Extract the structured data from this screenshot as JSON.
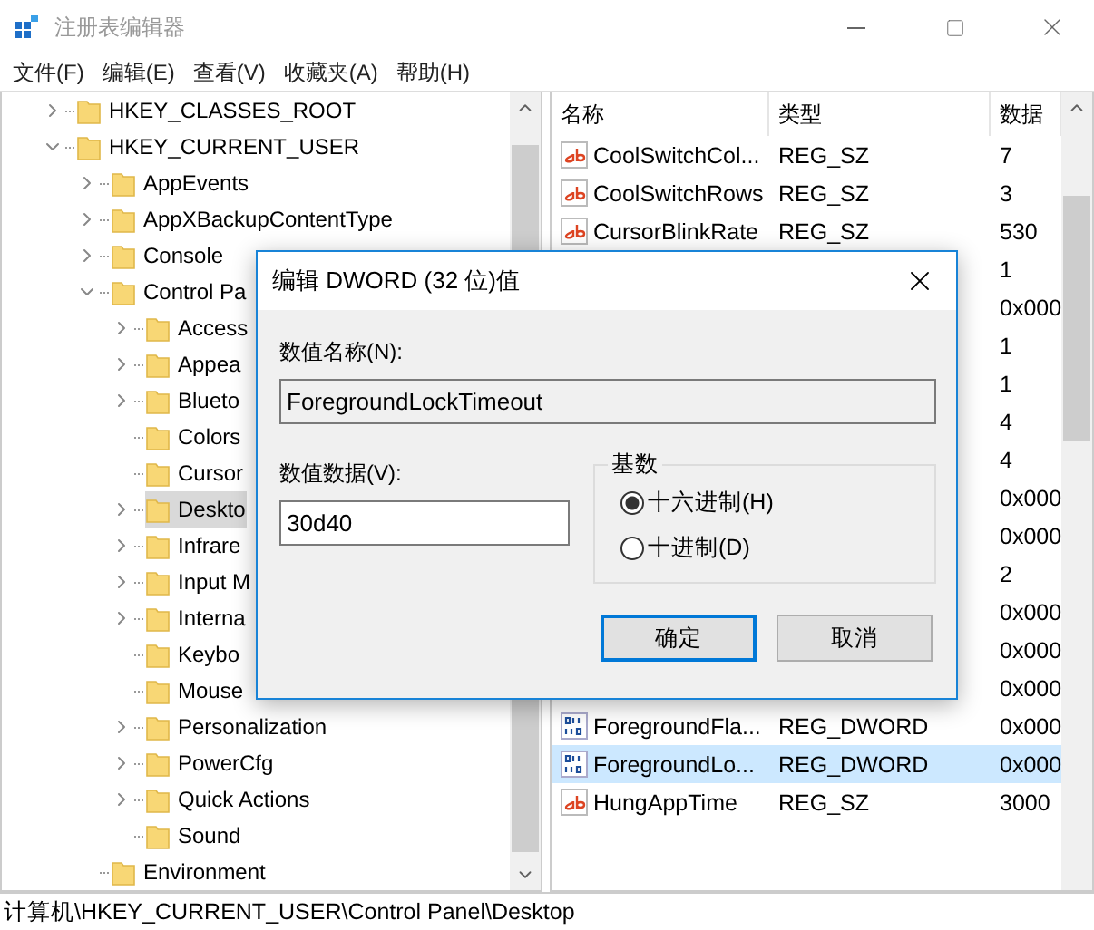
{
  "window": {
    "title": "注册表编辑器"
  },
  "menu": [
    "文件(F)",
    "编辑(E)",
    "查看(V)",
    "收藏夹(A)",
    "帮助(H)"
  ],
  "tree": [
    {
      "kind": "branch",
      "label": "HKEY_CLASSES_ROOT",
      "expanded": false,
      "selected": false
    },
    {
      "kind": "branch",
      "label": "HKEY_CURRENT_USER",
      "expanded": true,
      "selected": false,
      "children": [
        {
          "kind": "branch",
          "label": "AppEvents",
          "expanded": false,
          "selected": false
        },
        {
          "kind": "branch",
          "label": "AppXBackupContentType",
          "expanded": false,
          "selected": false
        },
        {
          "kind": "branch",
          "label": "Console",
          "expanded": false,
          "selected": false
        },
        {
          "kind": "branch",
          "label": "Control Pa",
          "expanded": true,
          "selected": false,
          "children": [
            {
              "kind": "branch",
              "label": "Access",
              "expanded": false,
              "selected": false
            },
            {
              "kind": "branch",
              "label": "Appea",
              "expanded": false,
              "selected": false
            },
            {
              "kind": "branch",
              "label": "Blueto",
              "expanded": false,
              "selected": false
            },
            {
              "kind": "leaf",
              "label": "Colors",
              "selected": false
            },
            {
              "kind": "leaf",
              "label": "Cursor",
              "selected": false
            },
            {
              "kind": "branch",
              "label": "Deskto",
              "expanded": false,
              "selected": true
            },
            {
              "kind": "branch",
              "label": "Infrare",
              "expanded": false,
              "selected": false
            },
            {
              "kind": "branch",
              "label": "Input M",
              "expanded": false,
              "selected": false
            },
            {
              "kind": "branch",
              "label": "Interna",
              "expanded": false,
              "selected": false
            },
            {
              "kind": "leaf",
              "label": "Keybo",
              "selected": false
            },
            {
              "kind": "leaf",
              "label": "Mouse",
              "selected": false
            },
            {
              "kind": "branch",
              "label": "Personalization",
              "expanded": false,
              "selected": false
            },
            {
              "kind": "branch",
              "label": "PowerCfg",
              "expanded": false,
              "selected": false
            },
            {
              "kind": "branch",
              "label": "Quick Actions",
              "expanded": false,
              "selected": false
            },
            {
              "kind": "leaf",
              "label": "Sound",
              "selected": false
            }
          ]
        },
        {
          "kind": "leaf",
          "label": "Environment",
          "selected": false
        }
      ]
    }
  ],
  "list": {
    "columns": [
      "名称",
      "类型",
      "数据"
    ],
    "rows": [
      {
        "kind": "string",
        "name": "CoolSwitchCol...",
        "type": "REG_SZ",
        "data": "7",
        "selected": false
      },
      {
        "kind": "string",
        "name": "CoolSwitchRows",
        "type": "REG_SZ",
        "data": "3",
        "selected": false
      },
      {
        "kind": "string",
        "name": "CursorBlinkRate",
        "type": "REG_SZ",
        "data": "530",
        "selected": false
      },
      {
        "data": "1",
        "selected": false
      },
      {
        "data": "0x000",
        "selected": false
      },
      {
        "data": "1",
        "selected": false
      },
      {
        "data": "1",
        "selected": false
      },
      {
        "data": "4",
        "selected": false
      },
      {
        "data": "4",
        "selected": false
      },
      {
        "data": "0x000",
        "selected": false
      },
      {
        "data": "0x000",
        "selected": false
      },
      {
        "data": "2",
        "selected": false
      },
      {
        "data": "0x000",
        "selected": false
      },
      {
        "data": "0x000",
        "selected": false
      },
      {
        "data": "0x000",
        "selected": false
      },
      {
        "kind": "binary",
        "name": "ForegroundFla...",
        "type": "REG_DWORD",
        "data": "0x000",
        "selected": false
      },
      {
        "kind": "binary",
        "name": "ForegroundLo...",
        "type": "REG_DWORD",
        "data": "0x000",
        "selected": true
      },
      {
        "kind": "string",
        "name": "HungAppTime",
        "type": "REG_SZ",
        "data": "3000",
        "selected": false
      }
    ]
  },
  "dialog": {
    "title": "编辑 DWORD (32 位)值",
    "name_label": "数值名称(N):",
    "name_value": "ForegroundLockTimeout",
    "data_label": "数值数据(V):",
    "data_value": "30d40",
    "base_label": "基数",
    "bases": [
      {
        "label": "十六进制(H)",
        "selected": true
      },
      {
        "label": "十进制(D)",
        "selected": false
      }
    ],
    "buttons": [
      {
        "label": "确定",
        "default": true
      },
      {
        "label": "取消",
        "default": false
      }
    ]
  },
  "status_bar": "计算机\\HKEY_CURRENT_USER\\Control Panel\\Desktop"
}
